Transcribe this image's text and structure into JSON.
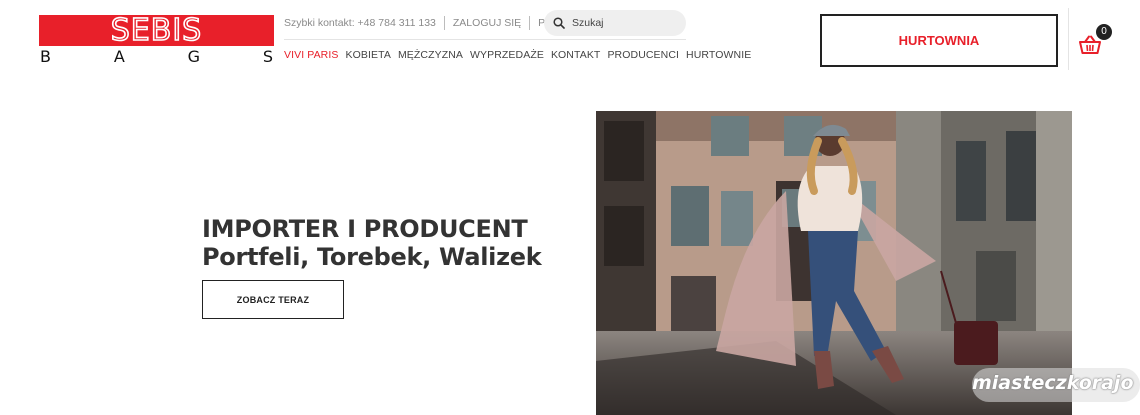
{
  "logo": {
    "word": "SEBIS",
    "letters": [
      "B",
      "A",
      "G",
      "S"
    ]
  },
  "topbar": {
    "contact_label": "Szybki kontakt:",
    "contact_phone": "+48 784 311 133",
    "login": "ZALOGUJ SIĘ",
    "currency": "PLN",
    "search_placeholder": "Szukaj"
  },
  "menu": [
    {
      "label": "VIVI PARIS",
      "active": true
    },
    {
      "label": "KOBIETA"
    },
    {
      "label": "MĘŻCZYZNA"
    },
    {
      "label": "WYPRZEDAŻE"
    },
    {
      "label": "KONTAKT"
    },
    {
      "label": "PRODUCENCI"
    },
    {
      "label": "HURTOWNIE"
    }
  ],
  "wholesale_button": "Hurtownia",
  "cart": {
    "count": "0"
  },
  "hero": {
    "title_line1": "IMPORTER I PRODUCENT",
    "title_line2": "Portfeli, Torebek, Walizek",
    "cta": "ZOBACZ TERAZ"
  },
  "watermark": "miasteczkorajo",
  "colors": {
    "brand_red": "#e8202a",
    "text_dark": "#333333"
  }
}
